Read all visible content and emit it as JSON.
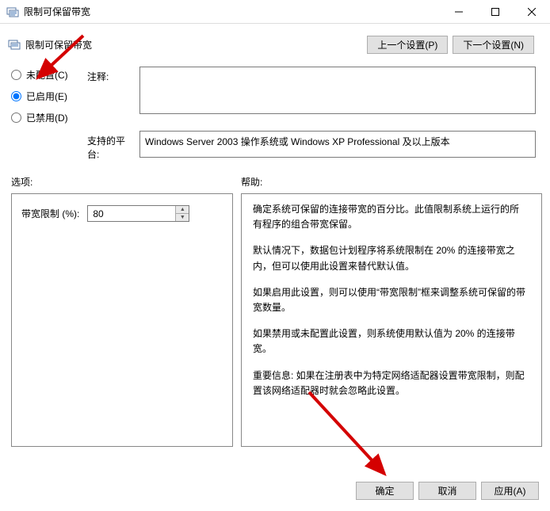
{
  "window": {
    "title": "限制可保留带宽",
    "subtitle": "限制可保留带宽"
  },
  "nav": {
    "prev": "上一个设置(P)",
    "next": "下一个设置(N)"
  },
  "radios": {
    "not_configured": "未配置(C)",
    "enabled": "已启用(E)",
    "disabled": "已禁用(D)"
  },
  "labels": {
    "comment": "注释:",
    "platform": "支持的平台:",
    "options": "选项:",
    "help": "帮助:",
    "bandwidth_limit": "带宽限制 (%):"
  },
  "values": {
    "comment": "",
    "platform": "Windows Server 2003 操作系统或 Windows XP Professional 及以上版本",
    "bandwidth_limit": "80"
  },
  "help": {
    "p1": "确定系统可保留的连接带宽的百分比。此值限制系统上运行的所有程序的组合带宽保留。",
    "p2": "默认情况下，数据包计划程序将系统限制在 20% 的连接带宽之内，但可以使用此设置来替代默认值。",
    "p3": "如果启用此设置，则可以使用“带宽限制”框来调整系统可保留的带宽数量。",
    "p4": "如果禁用或未配置此设置，则系统使用默认值为 20% 的连接带宽。",
    "p5": "重要信息: 如果在注册表中为特定网络适配器设置带宽限制，则配置该网络适配器时就会忽略此设置。"
  },
  "footer": {
    "ok": "确定",
    "cancel": "取消",
    "apply": "应用(A)"
  }
}
